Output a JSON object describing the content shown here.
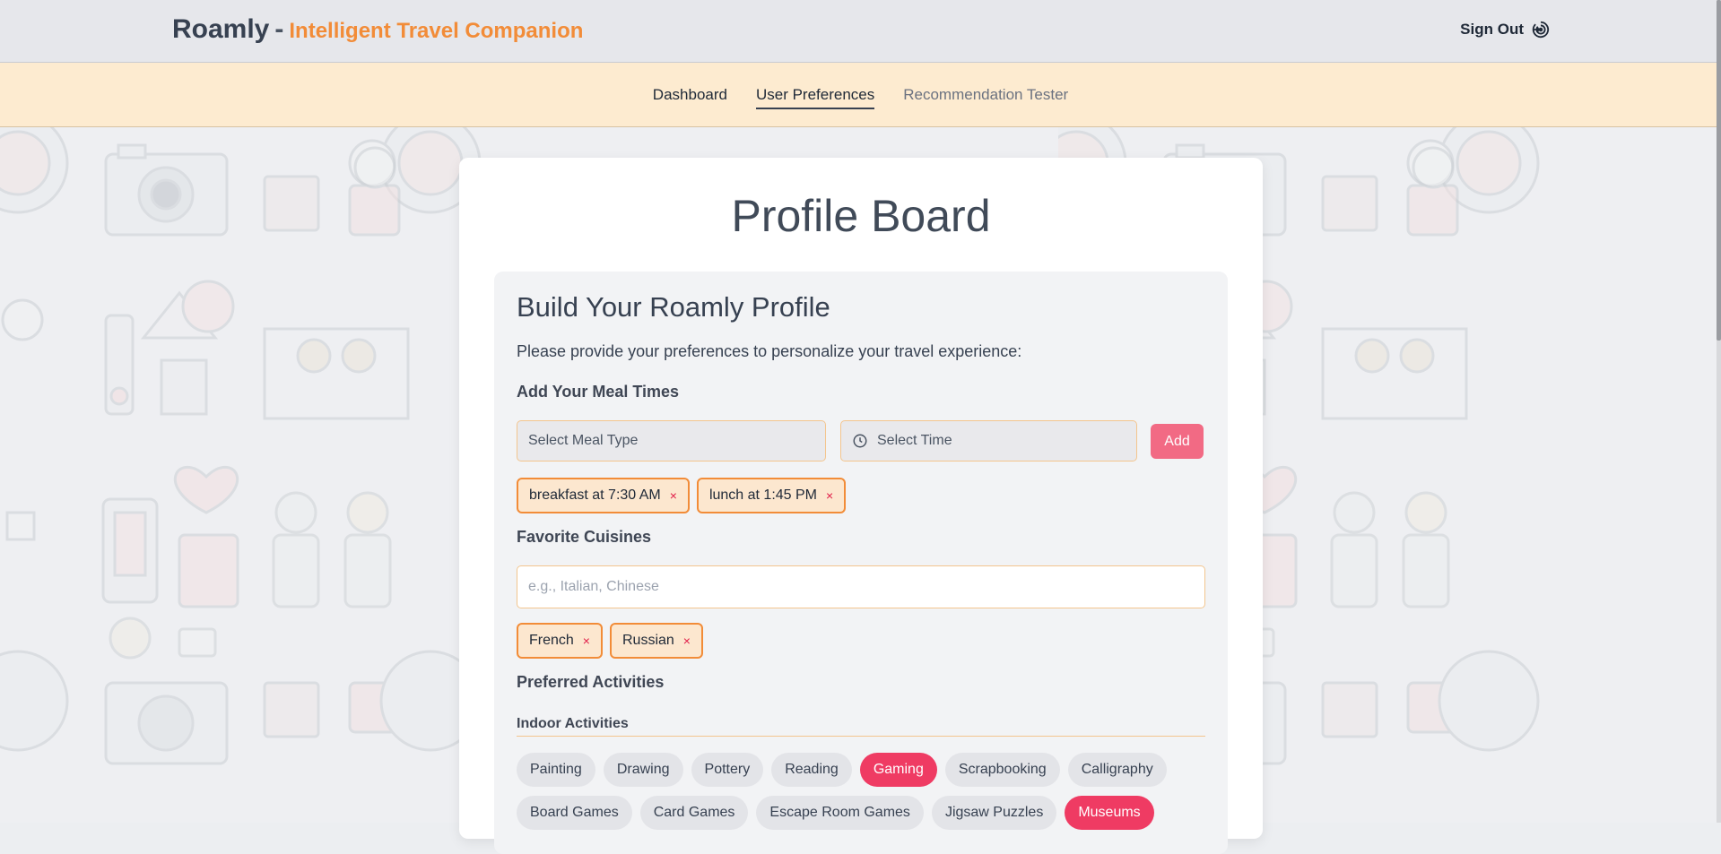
{
  "header": {
    "brand": "Roamly",
    "separator": "-",
    "tagline": "Intelligent Travel Companion",
    "sign_out": "Sign Out"
  },
  "nav": {
    "items": [
      {
        "label": "Dashboard"
      },
      {
        "label": "User Preferences"
      },
      {
        "label": "Recommendation Tester"
      }
    ],
    "active": "User Preferences"
  },
  "card": {
    "title": "Profile Board"
  },
  "panel": {
    "title": "Build Your Roamly Profile",
    "subtitle": "Please provide your preferences to personalize your travel experience:",
    "meal_times": {
      "label": "Add Your Meal Times",
      "meal_type_placeholder": "Select Meal Type",
      "time_placeholder": "Select Time",
      "add_label": "Add",
      "entries": [
        {
          "text": "breakfast at 7:30 AM",
          "remove": "×"
        },
        {
          "text": "lunch at 1:45 PM",
          "remove": "×"
        }
      ]
    },
    "cuisines": {
      "label": "Favorite Cuisines",
      "placeholder": "e.g., Italian, Chinese",
      "entries": [
        {
          "text": "French",
          "remove": "×"
        },
        {
          "text": "Russian",
          "remove": "×"
        }
      ]
    },
    "activities": {
      "label": "Preferred Activities",
      "indoor_label": "Indoor Activities",
      "row1": [
        {
          "label": "Painting",
          "selected": false
        },
        {
          "label": "Drawing",
          "selected": false
        },
        {
          "label": "Pottery",
          "selected": false
        },
        {
          "label": "Reading",
          "selected": false
        },
        {
          "label": "Gaming",
          "selected": true
        },
        {
          "label": "Scrapbooking",
          "selected": false
        },
        {
          "label": "Calligraphy",
          "selected": false
        }
      ],
      "row2": [
        {
          "label": "Board Games",
          "selected": false
        },
        {
          "label": "Card Games",
          "selected": false
        },
        {
          "label": "Escape Room Games",
          "selected": false
        },
        {
          "label": "Jigsaw Puzzles",
          "selected": false
        },
        {
          "label": "Museums",
          "selected": true
        }
      ]
    }
  },
  "colors": {
    "accent_orange": "#f28c38",
    "selected_pill": "#ef3b63",
    "add_button": "#f26a84",
    "nav_bg": "#fdebd0"
  }
}
